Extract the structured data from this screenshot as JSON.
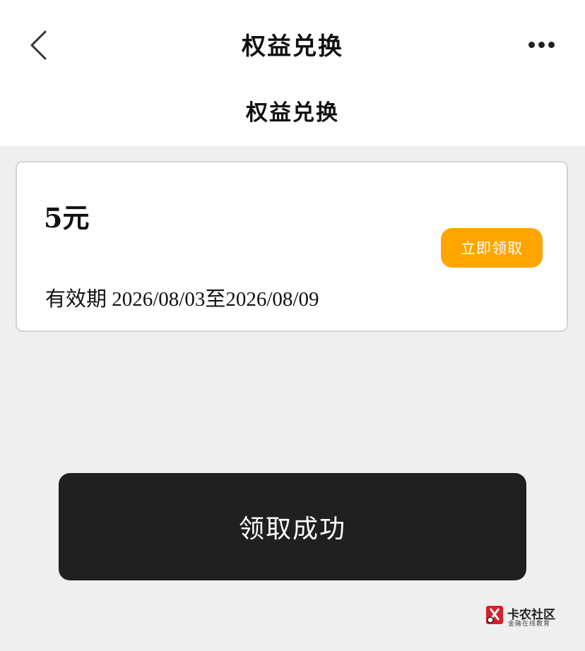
{
  "header": {
    "title": "权益兑换",
    "back_icon": "chevron-left-icon",
    "more_icon": "more-horizontal-icon"
  },
  "page": {
    "heading": "权益兑换"
  },
  "coupon": {
    "amount": "5元",
    "claim_button": "立即领取",
    "validity": "有效期 2026/08/03至2026/08/09"
  },
  "toast": {
    "message": "领取成功"
  },
  "watermark": {
    "name": "卡农社区",
    "tagline": "金融在线教育"
  },
  "colors": {
    "accent": "#ffa500",
    "background": "#efefef",
    "toast_bg": "#202020"
  }
}
